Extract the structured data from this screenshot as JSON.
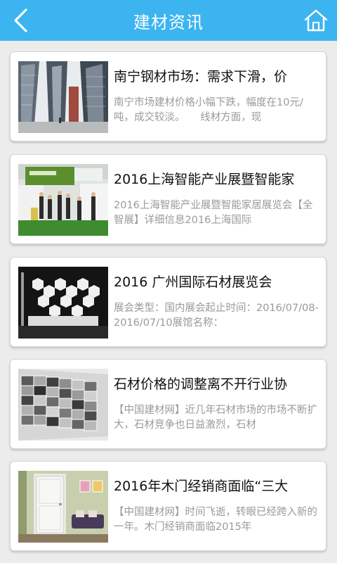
{
  "header": {
    "title": "建材资讯",
    "back_icon": "chevron-left-icon",
    "home_icon": "home-icon",
    "bar_color": "#3cb4f0"
  },
  "articles": [
    {
      "title": "南宁钢材市场：需求下滑，价",
      "summary": "南宁市场建材价格小幅下跌，幅度在10元/吨，成交较淡。　　线材方面，现"
    },
    {
      "title": "2016上海智能产业展暨智能家",
      "summary": "2016上海智能产业展暨智能家居展览会【全智展】详细信息2016上海国际"
    },
    {
      "title": "2016 广州国际石材展览会",
      "summary": "展会类型：国内展会起止时间：2016/07/08-2016/07/10展馆名称："
    },
    {
      "title": "石材价格的调整离不开行业协",
      "summary": "【中国建材网】近几年石材市场的市场不断扩大，石材竞争也日益激烈，石材"
    },
    {
      "title": "2016年木门经销商面临“三大",
      "summary": "【中国建材网】时间飞逝，转眼已经跨入新的一年。木门经销商面临2015年"
    }
  ]
}
